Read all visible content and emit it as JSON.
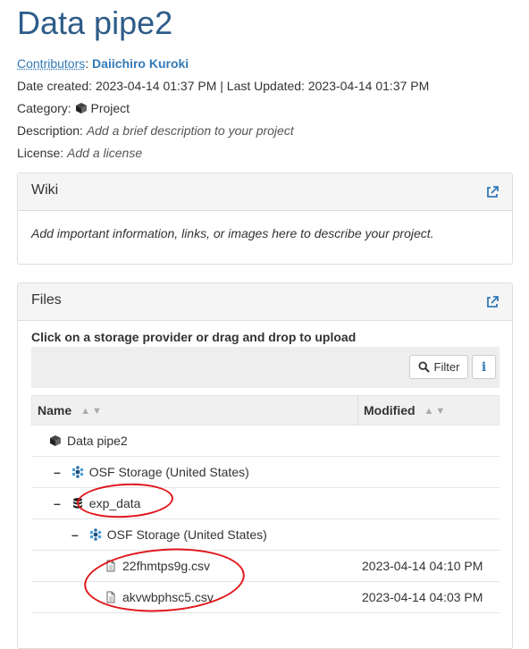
{
  "project": {
    "title": "Data pipe2",
    "contributors_label": "Contributors",
    "contributor": "Daiichiro Kuroki",
    "dates_label": "Date created:",
    "dates_value": "2023-04-14 01:37 PM | Last Updated: 2023-04-14 01:37 PM",
    "category_label": "Category:",
    "category_value": "Project",
    "description_label": "Description:",
    "description_value": "Add a brief description to your project",
    "license_label": "License:",
    "license_value": "Add a license"
  },
  "wiki": {
    "title": "Wiki",
    "body": "Add important information, links, or images here to describe your project."
  },
  "files": {
    "title": "Files",
    "upload_msg": "Click on a storage provider or drag and drop to upload",
    "filter_label": "Filter",
    "info_label": "i",
    "columns": {
      "name": "Name",
      "modified": "Modified"
    },
    "rows": [
      {
        "name": "Data pipe2",
        "icon": "cube-icon",
        "modified": ""
      },
      {
        "name": "OSF Storage (United States)",
        "icon": "osf-storage-icon",
        "modified": ""
      },
      {
        "name": "exp_data",
        "icon": "database-icon",
        "modified": ""
      },
      {
        "name": "OSF Storage (United States)",
        "icon": "osf-storage-icon",
        "modified": ""
      },
      {
        "name": "22fhmtps9g.csv",
        "icon": "file-icon",
        "modified": "2023-04-14 04:10 PM"
      },
      {
        "name": "akvwbphsc5.csv",
        "icon": "file-icon",
        "modified": "2023-04-14 04:03 PM"
      }
    ]
  },
  "colors": {
    "link": "#337ab7",
    "annotation": "#e0151b"
  }
}
